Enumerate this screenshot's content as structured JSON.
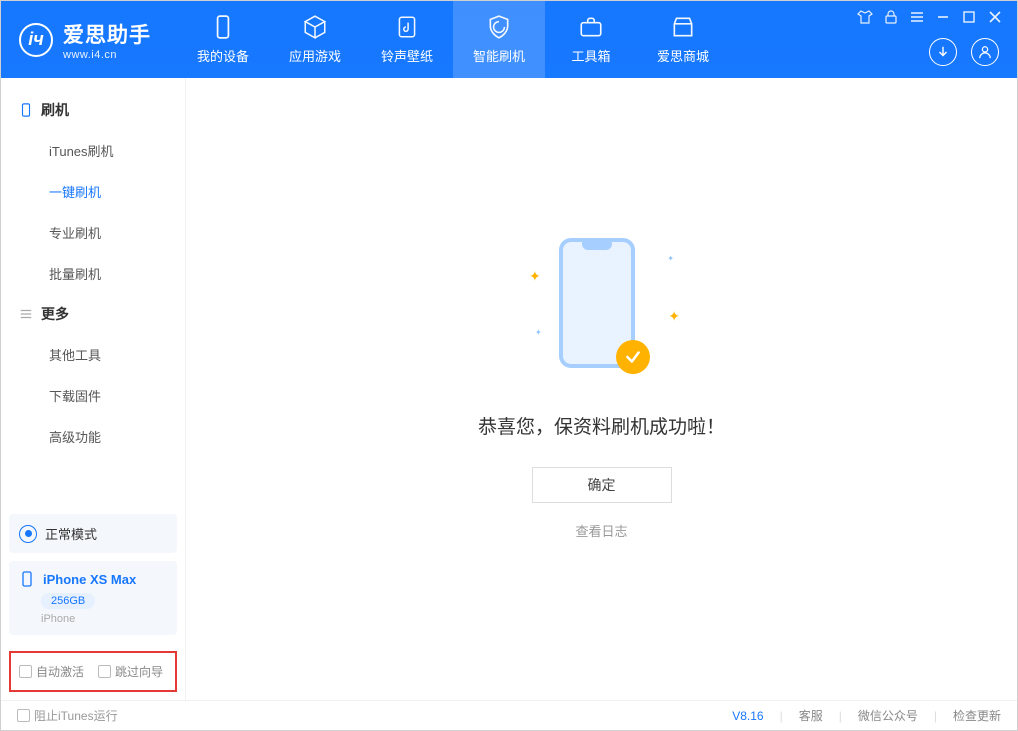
{
  "app": {
    "title": "爱思助手",
    "subtitle": "www.i4.cn"
  },
  "tabs": [
    {
      "label": "我的设备",
      "icon": "device"
    },
    {
      "label": "应用游戏",
      "icon": "cube"
    },
    {
      "label": "铃声壁纸",
      "icon": "music"
    },
    {
      "label": "智能刷机",
      "icon": "shield",
      "active": true
    },
    {
      "label": "工具箱",
      "icon": "toolbox"
    },
    {
      "label": "爱思商城",
      "icon": "store"
    }
  ],
  "sidebar": {
    "group1": {
      "title": "刷机",
      "items": [
        "iTunes刷机",
        "一键刷机",
        "专业刷机",
        "批量刷机"
      ],
      "active_index": 1
    },
    "group2": {
      "title": "更多",
      "items": [
        "其他工具",
        "下载固件",
        "高级功能"
      ]
    },
    "status": "正常模式",
    "device": {
      "name": "iPhone XS Max",
      "storage": "256GB",
      "type": "iPhone"
    },
    "checks": {
      "auto_activate": "自动激活",
      "skip_guide": "跳过向导"
    }
  },
  "main": {
    "success_message": "恭喜您，保资料刷机成功啦！",
    "ok_button": "确定",
    "view_log": "查看日志"
  },
  "footer": {
    "block_itunes": "阻止iTunes运行",
    "version": "V8.16",
    "links": [
      "客服",
      "微信公众号",
      "检查更新"
    ]
  }
}
